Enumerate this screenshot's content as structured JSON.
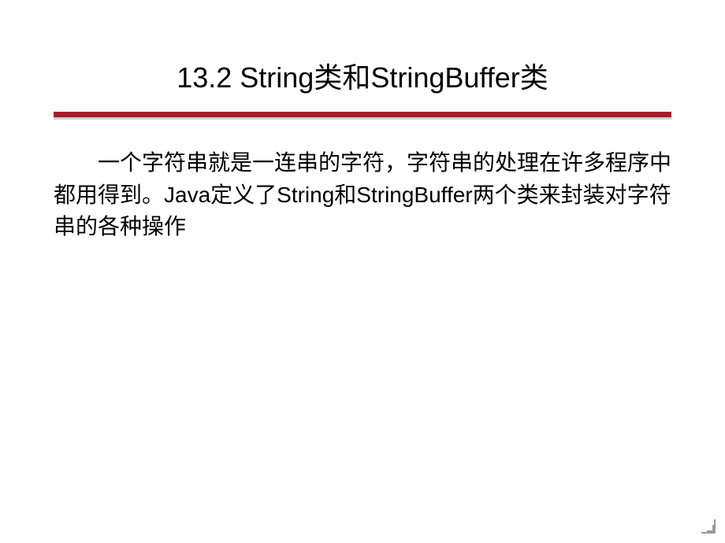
{
  "slide": {
    "title": "13.2  String类和StringBuffer类",
    "body": "一个字符串就是一连串的字符，字符串的处理在许多程序中都用得到。Java定义了String和StringBuffer两个类来封装对字符串的各种操作"
  }
}
